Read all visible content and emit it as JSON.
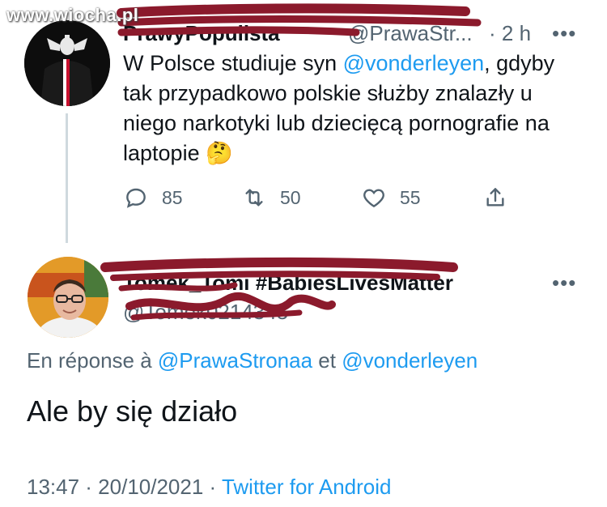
{
  "watermark": "www.wiocha.pl",
  "tweet1": {
    "name": "PrawyPopulista",
    "handle": "@PrawaStr...",
    "time": "· 2 h",
    "text_before": "W Polsce studiuje syn ",
    "mention": "@vonderleyen",
    "text_after": ", gdyby tak przypadkowo polskie służby znalazły u niego narkotyki lub dziecięcą pornografie na laptopie 🤔",
    "replies": "85",
    "retweets": "50",
    "likes": "55",
    "more": "•••"
  },
  "tweet2": {
    "name": "Tomek_Tomi #BabiesLivesMatter",
    "handle": "@Tomek0214345",
    "more": "•••",
    "reply_prefix": "En réponse à ",
    "reply_mention1": "@PrawaStronaa",
    "reply_and": " et ",
    "reply_mention2": "@vonderleyen",
    "text": "Ale by się działo",
    "timestamp": "13:47 · 20/10/2021 · ",
    "source": "Twitter for Android"
  },
  "colors": {
    "accent": "#1d9bf0",
    "secondary_text": "#536471",
    "redaction": "#8b1a2c"
  }
}
